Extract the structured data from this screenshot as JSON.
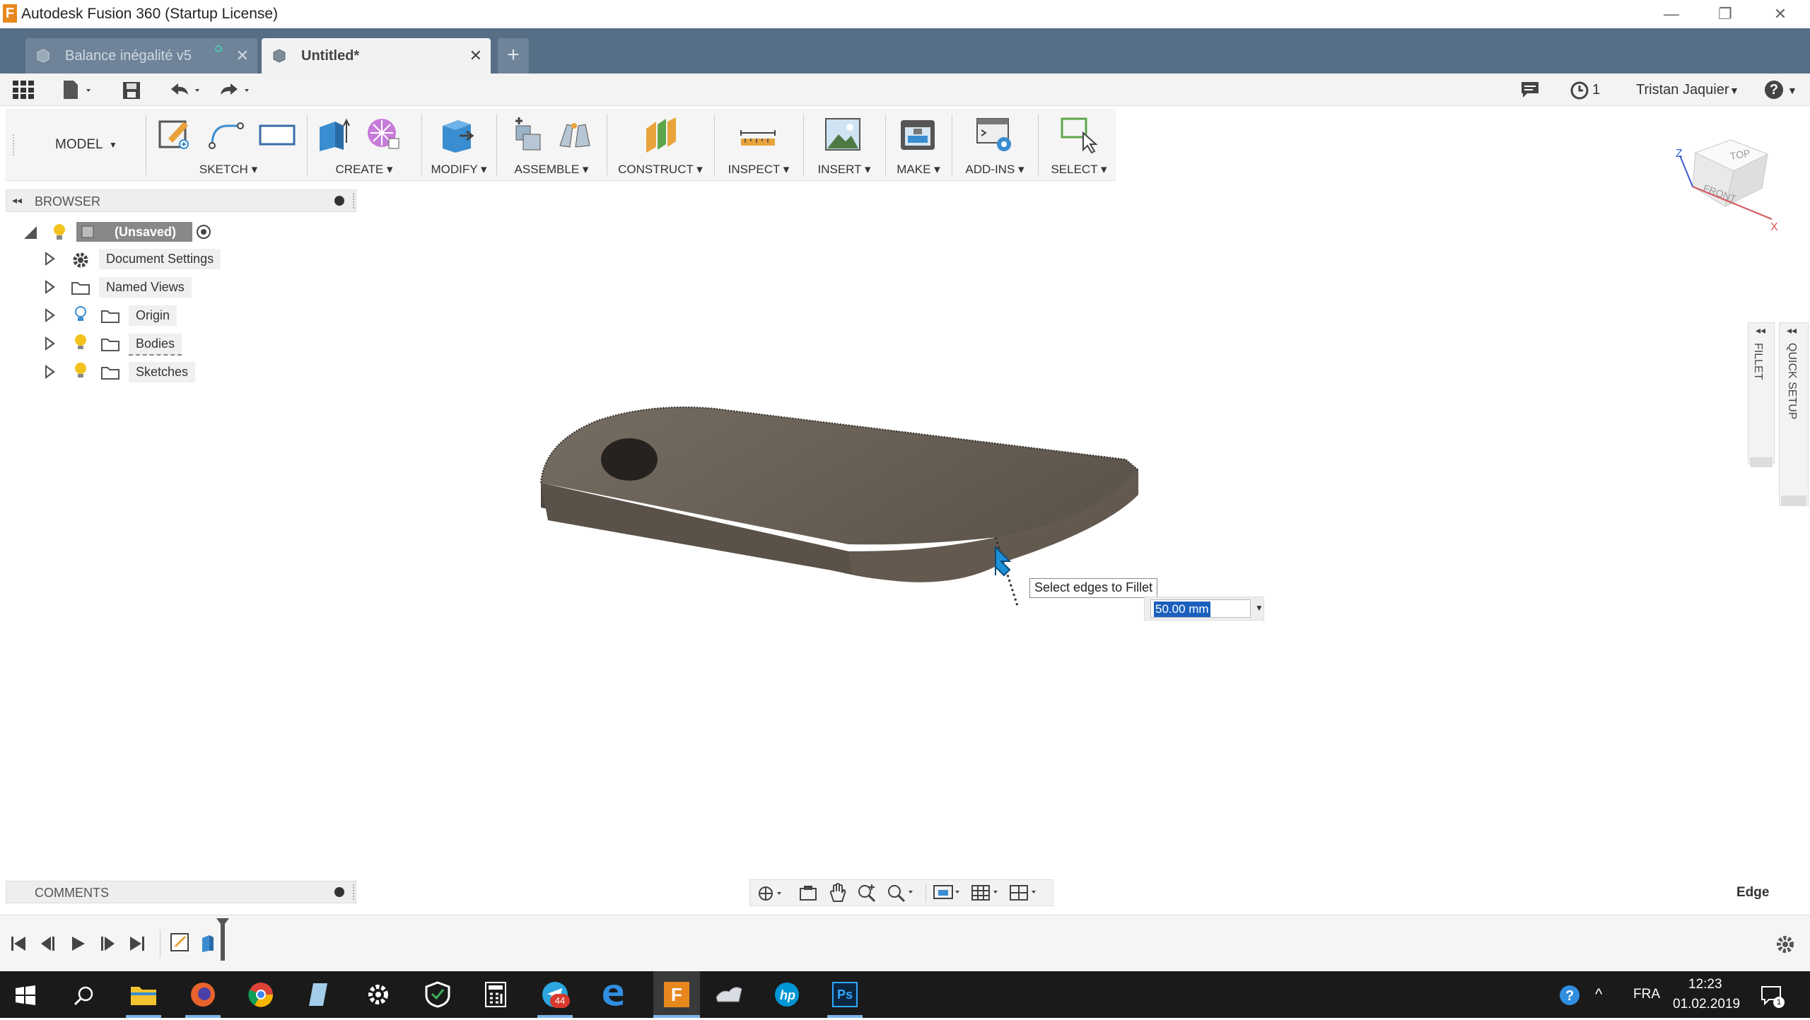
{
  "window": {
    "app_logo": "F",
    "title": "Autodesk Fusion 360 (Startup License)",
    "controls": [
      "—",
      "❐",
      "✕"
    ]
  },
  "tabs": [
    {
      "label": "Balance inégalité v5",
      "close": "✕",
      "active": false
    },
    {
      "label": "Untitled*",
      "close": "✕",
      "active": true
    }
  ],
  "tab_add": "+",
  "quick_access": {
    "jobs_count": "1",
    "user": "Tristan Jaquier",
    "help": "?"
  },
  "toolbar": {
    "workspace": "MODEL",
    "groups": [
      {
        "label": "SKETCH"
      },
      {
        "label": "CREATE"
      },
      {
        "label": "MODIFY"
      },
      {
        "label": "ASSEMBLE"
      },
      {
        "label": "CONSTRUCT"
      },
      {
        "label": "INSPECT"
      },
      {
        "label": "INSERT"
      },
      {
        "label": "MAKE"
      },
      {
        "label": "ADD-INS"
      },
      {
        "label": "SELECT"
      }
    ]
  },
  "browser": {
    "title": "BROWSER",
    "root": "(Unsaved)",
    "items": [
      {
        "label": "Document Settings",
        "icon": "gear-icon"
      },
      {
        "label": "Named Views",
        "icon": "folder-icon"
      },
      {
        "label": "Origin",
        "icon": "folder-icon"
      },
      {
        "label": "Bodies",
        "icon": "folder-icon"
      },
      {
        "label": "Sketches",
        "icon": "folder-icon"
      }
    ]
  },
  "viewcube": {
    "top": "TOP",
    "front": "FRONT",
    "axis_x": "X",
    "axis_z": "Z"
  },
  "side_panels": {
    "fillet": "FILLET",
    "quick_setup": "QUICK SETUP"
  },
  "viewport": {
    "tooltip": "Select edges to Fillet",
    "input_value": "50.00 mm",
    "selection_filter": "Edge"
  },
  "comments": {
    "title": "COMMENTS"
  },
  "taskbar": {
    "language": "FRA",
    "time": "12:23",
    "date": "01.02.2019",
    "telegram_badge": "44",
    "notif_badge": "1"
  },
  "colors": {
    "tabbar": "#566f87",
    "accent": "#0696d7",
    "model": "#6e655b"
  }
}
